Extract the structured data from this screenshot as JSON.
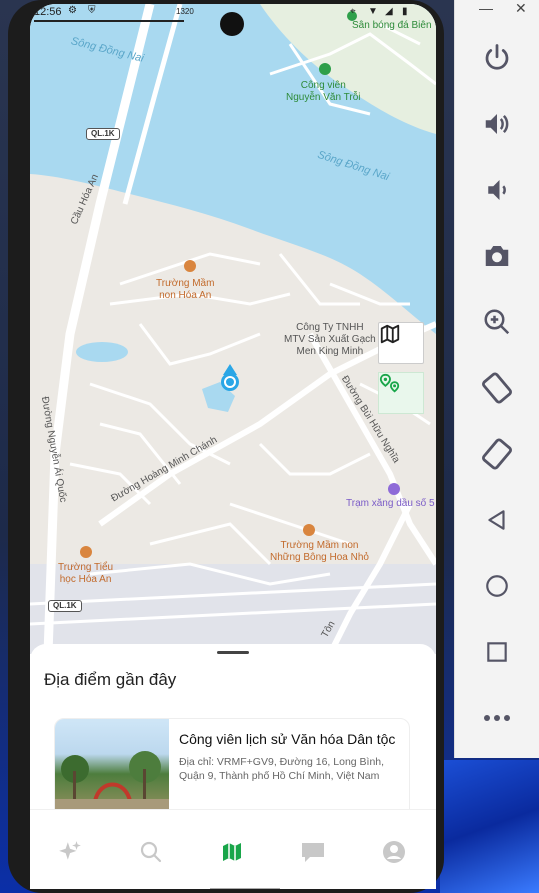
{
  "status": {
    "time": "12:56",
    "right_text": "1320"
  },
  "map": {
    "labels": {
      "poi_top_right": "Sân bóng đá Biên",
      "park": "Công viên\nNguyễn Văn Trỗi",
      "river_1": "Sông Đồng Nai",
      "river_2": "Sông Đồng Nai",
      "bridge": "Cầu Hóa An",
      "school_1": "Trường Mầm\nnon Hóa An",
      "company": "Công Ty TNHH\nMTV Sản Xuất Gạch\nMen King Minh",
      "street_bui": "Đường Bùi Hữu Nghĩa",
      "street_nguyen": "Đường Nguyễn Ái Quốc",
      "street_hoang": "Đường Hoàng Minh Chánh",
      "gas": "Trạm xăng dầu số 5",
      "school_2": "Trường Mầm non\nNhững Bông Hoa Nhỏ",
      "school_3": "Trường Tiểu\nhọc Hóa An",
      "street_ton": "Tôn",
      "shield_1": "QL.1K",
      "shield_2": "QL.1K"
    },
    "buttons": {
      "layers_icon": "map-icon",
      "route_icon": "route-icon"
    }
  },
  "sheet": {
    "title": "Địa điểm gần đây",
    "places": [
      {
        "name": "Công viên lịch sử Văn hóa Dân tộc",
        "address": "Địa chỉ: VRMF+GV9, Đường 16, Long Bình, Quận 9, Thành phố Hồ Chí Minh, Việt Nam"
      }
    ]
  },
  "nav": {
    "items": [
      {
        "icon": "sparkle-icon",
        "active": false
      },
      {
        "icon": "search-icon",
        "active": false
      },
      {
        "icon": "map-icon",
        "active": true
      },
      {
        "icon": "chat-icon",
        "active": false
      },
      {
        "icon": "profile-icon",
        "active": false
      }
    ],
    "active_color": "#19a64a",
    "inactive_color": "#c8c8c8"
  },
  "emulator": {
    "window_controls": {
      "minimize": "—",
      "close": "✕"
    },
    "buttons": [
      "power-icon",
      "volume-up-icon",
      "volume-down-icon",
      "camera-icon",
      "zoom-icon",
      "rotate-left-icon",
      "rotate-right-icon",
      "back-icon",
      "home-icon",
      "overview-icon",
      "more-icon"
    ]
  },
  "colors": {
    "water": "#a9d9f0",
    "land": "#ece9e4",
    "road": "#ffffff",
    "accent": "#19a64a"
  }
}
